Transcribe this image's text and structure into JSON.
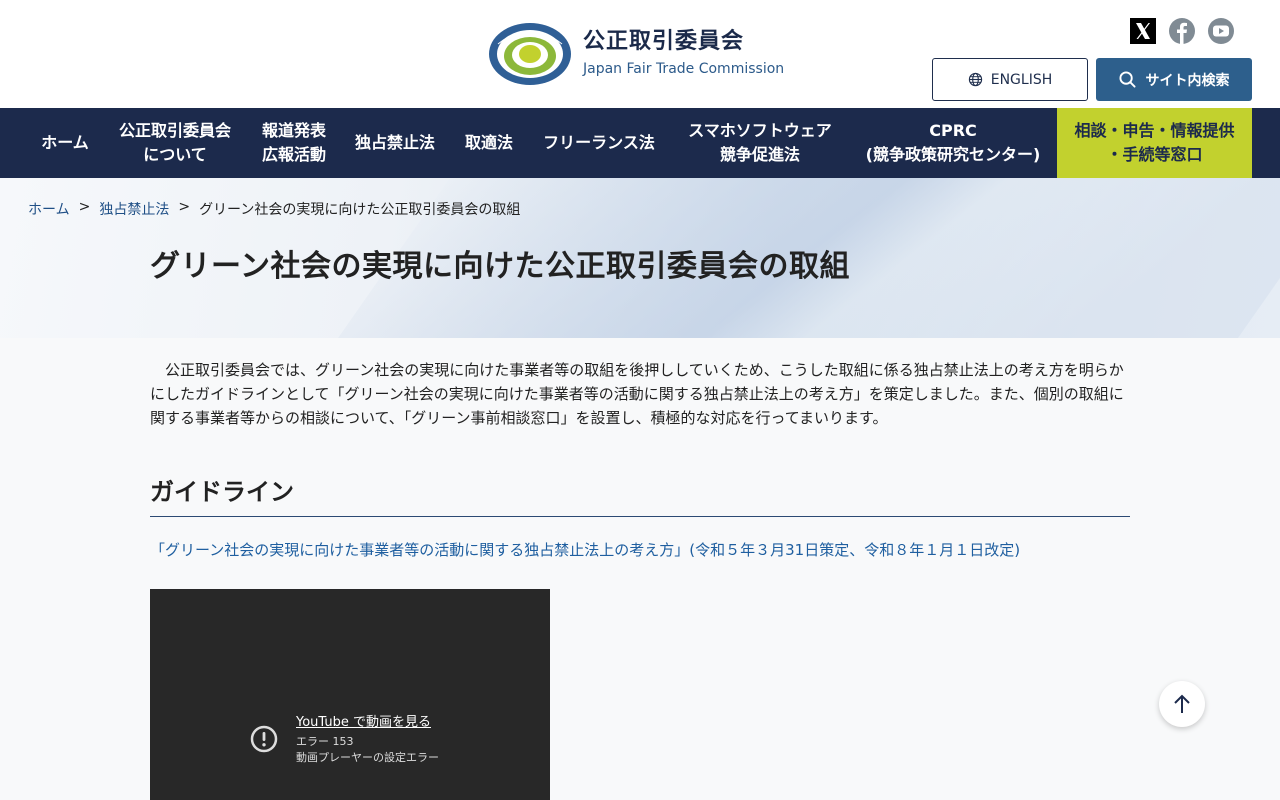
{
  "header": {
    "logo_ja": "公正取引委員会",
    "logo_en": "Japan Fair Trade Commission",
    "social": [
      "x-icon",
      "facebook-icon",
      "youtube-icon"
    ],
    "english_label": "ENGLISH",
    "search_label": "サイト内検索"
  },
  "nav": {
    "items": [
      {
        "label": "ホーム"
      },
      {
        "label": "公正取引委員会\nについて"
      },
      {
        "label": "報道発表\n広報活動"
      },
      {
        "label": "独占禁止法"
      },
      {
        "label": "取適法"
      },
      {
        "label": "フリーランス法"
      },
      {
        "label": "スマホソフトウェア\n競争促進法"
      },
      {
        "label": "CPRC\n(競争政策研究センター)"
      },
      {
        "label": "相談・申告・情報提供\n・手続等窓口"
      }
    ]
  },
  "breadcrumb": {
    "items": [
      "ホーム",
      "独占禁止法",
      "グリーン社会の実現に向けた公正取引委員会の取組"
    ],
    "separator": ">"
  },
  "page": {
    "title": "グリーン社会の実現に向けた公正取引委員会の取組",
    "intro": "公正取引委員会では、グリーン社会の実現に向けた事業者等の取組を後押ししていくため、こうした取組に係る独占禁止法上の考え方を明らかにしたガイドラインとして「グリーン社会の実現に向けた事業者等の活動に関する独占禁止法上の考え方」を策定しました。また、個別の取組に関する事業者等からの相談について、「グリーン事前相談窓口」を設置し、積極的な対応を行ってまいります。",
    "section_title": "ガイドライン",
    "guideline_link": "「グリーン社会の実現に向けた事業者等の活動に関する独占禁止法上の考え方」(令和５年３月31日策定、令和８年１月１日改定)"
  },
  "video": {
    "title": "YouTube で動画を見る",
    "code": "エラー 153",
    "message": "動画プレーヤーの設定エラー"
  },
  "colors": {
    "nav_bg": "#1c2a4c",
    "accent": "#c2d12e",
    "search_bg": "#2d5f8c",
    "link": "#1f5fa0"
  }
}
